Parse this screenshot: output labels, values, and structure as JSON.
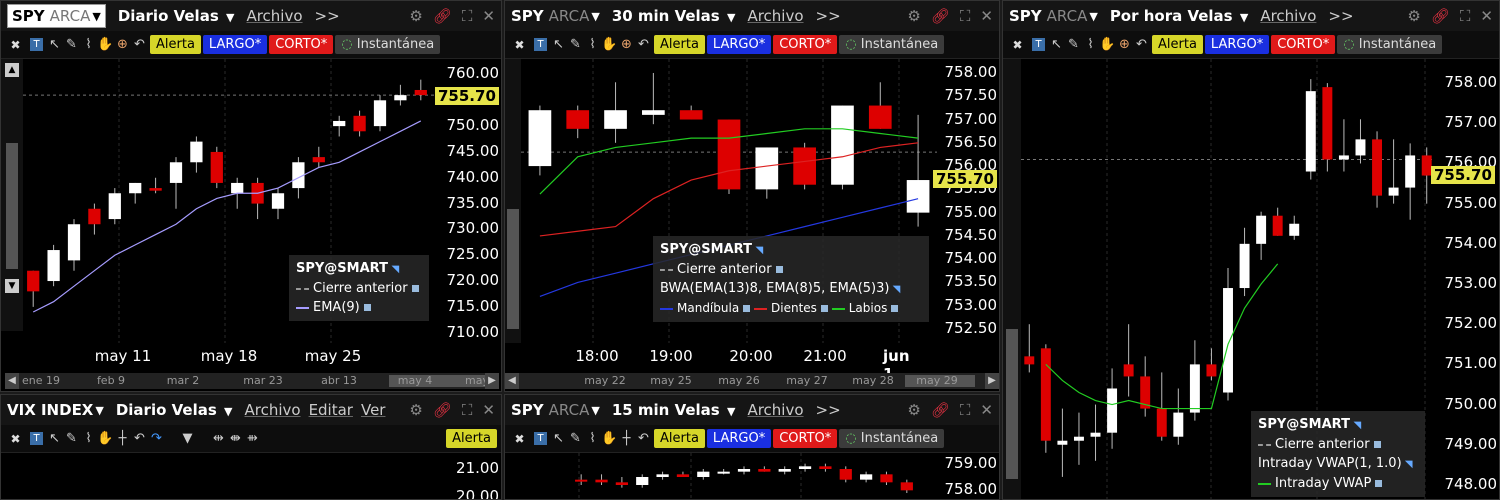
{
  "panels": {
    "p1": {
      "symbol": "SPY",
      "exchange": "ARCA",
      "title": "Diario Velas",
      "menu": "Archivo",
      "more": ">>",
      "buttons": {
        "alert": "Alerta",
        "long": "LARGO*",
        "short": "CORTO*",
        "snapshot": "Instantánea"
      },
      "last_price": "755.70",
      "y_labels": [
        "760.00",
        "755.00",
        "750.00",
        "745.00",
        "740.00",
        "735.00",
        "730.00",
        "725.00",
        "720.00",
        "715.00",
        "710.00"
      ],
      "x_labels": [
        "may 11",
        "may 18",
        "may 25"
      ],
      "nav_labels": [
        "ene 19",
        "feb 9",
        "mar 2",
        "mar 23",
        "abr 13",
        "may 4",
        "may"
      ],
      "legend": {
        "head": "SPY@SMART",
        "prev_close": "Cierre anterior",
        "ema": "EMA(9)"
      }
    },
    "p2": {
      "symbol": "SPY",
      "exchange": "ARCA",
      "title": "30 min Velas",
      "menu": "Archivo",
      "more": ">>",
      "buttons": {
        "alert": "Alerta",
        "long": "LARGO*",
        "short": "CORTO*",
        "snapshot": "Instantánea"
      },
      "last_price": "755.70",
      "y_labels": [
        "758.00",
        "757.50",
        "757.00",
        "756.50",
        "756.00",
        "755.50",
        "755.00",
        "754.50",
        "754.00",
        "753.50",
        "753.00",
        "752.50"
      ],
      "x_labels": [
        "18:00",
        "19:00",
        "20:00",
        "21:00",
        "jun 1"
      ],
      "nav_labels": [
        "may 22",
        "may 25",
        "may 26",
        "may 27",
        "may 28",
        "may 29"
      ],
      "legend": {
        "head": "SPY@SMART",
        "prev_close": "Cierre anterior",
        "bwa": "BWA(EMA(13)8, EMA(8)5, EMA(5)3)",
        "jaw": "Mandíbula",
        "teeth": "Dientes",
        "lips": "Labios"
      }
    },
    "p3": {
      "symbol": "SPY",
      "exchange": "ARCA",
      "title": "Por hora Velas",
      "menu": "Archivo",
      "more": ">>",
      "buttons": {
        "alert": "Alerta",
        "long": "LARGO*",
        "short": "CORTO*",
        "snapshot": "Instantánea"
      },
      "last_price": "755.70",
      "y_labels": [
        "758.00",
        "757.00",
        "756.00",
        "755.00",
        "754.00",
        "753.00",
        "752.00",
        "751.00",
        "750.00",
        "749.00",
        "748.00"
      ],
      "legend": {
        "head": "SPY@SMART",
        "prev_close": "Cierre anterior",
        "vwap": "Intraday VWAP(1, 1.0)",
        "vwap_line": "Intraday VWAP"
      }
    },
    "p4": {
      "symbol": "VIX INDEX",
      "title": "Diario Velas",
      "menus": [
        "Archivo",
        "Editar",
        "Ver"
      ],
      "buttons": {
        "alert": "Alerta"
      },
      "y_labels": [
        "21.00",
        "20.00"
      ]
    },
    "p5": {
      "symbol": "SPY",
      "exchange": "ARCA",
      "title": "15 min Velas",
      "menu": "Archivo",
      "more": ">>",
      "buttons": {
        "alert": "Alerta",
        "long": "LARGO*",
        "short": "CORTO*",
        "snapshot": "Instantánea"
      },
      "y_labels": [
        "759.00",
        "758.00"
      ]
    }
  },
  "chart_data": [
    {
      "type": "candlestick",
      "title": "SPY ARCA Diario Velas",
      "ylim": [
        708,
        763
      ],
      "last": 755.7,
      "ema_label": "EMA(9)",
      "candles": [
        {
          "o": 718,
          "h": 722,
          "l": 715,
          "c": 722,
          "up": false
        },
        {
          "o": 720,
          "h": 727,
          "l": 719,
          "c": 726,
          "up": true
        },
        {
          "o": 724,
          "h": 732,
          "l": 722,
          "c": 731,
          "up": true
        },
        {
          "o": 731,
          "h": 735,
          "l": 729,
          "c": 734,
          "up": false
        },
        {
          "o": 732,
          "h": 738,
          "l": 731,
          "c": 737,
          "up": true
        },
        {
          "o": 737,
          "h": 739,
          "l": 735,
          "c": 739,
          "up": true
        },
        {
          "o": 738,
          "h": 740,
          "l": 737,
          "c": 737.5,
          "up": false
        },
        {
          "o": 739,
          "h": 744,
          "l": 734,
          "c": 743,
          "up": true
        },
        {
          "o": 743,
          "h": 748,
          "l": 741,
          "c": 747,
          "up": true
        },
        {
          "o": 745,
          "h": 746,
          "l": 738,
          "c": 739,
          "up": false
        },
        {
          "o": 739,
          "h": 740,
          "l": 734,
          "c": 737,
          "up": true
        },
        {
          "o": 739,
          "h": 740,
          "l": 732,
          "c": 735,
          "up": false
        },
        {
          "o": 734,
          "h": 738,
          "l": 732,
          "c": 737,
          "up": true
        },
        {
          "o": 738,
          "h": 744,
          "l": 736,
          "c": 743,
          "up": true
        },
        {
          "o": 744,
          "h": 746,
          "l": 742,
          "c": 743,
          "up": false
        },
        {
          "o": 750,
          "h": 752,
          "l": 748,
          "c": 751,
          "up": true
        },
        {
          "o": 752,
          "h": 753,
          "l": 748,
          "c": 749,
          "up": false
        },
        {
          "o": 750,
          "h": 756,
          "l": 749,
          "c": 755,
          "up": true
        },
        {
          "o": 755,
          "h": 758,
          "l": 754,
          "c": 756,
          "up": true
        },
        {
          "o": 757,
          "h": 759,
          "l": 755,
          "c": 756,
          "up": false
        }
      ],
      "ema": [
        714,
        716,
        719,
        722,
        725,
        727,
        729,
        731,
        734,
        736,
        737,
        737,
        738,
        740,
        742,
        743,
        745,
        747,
        749,
        751
      ]
    },
    {
      "type": "candlestick",
      "title": "SPY ARCA 30 min Velas",
      "ylim": [
        752.2,
        758.3
      ],
      "last": 755.7,
      "candles": [
        {
          "o": 757.2,
          "h": 757.3,
          "l": 755.8,
          "c": 756.0,
          "up": true
        },
        {
          "o": 757.2,
          "h": 757.3,
          "l": 756.6,
          "c": 756.8,
          "up": false
        },
        {
          "o": 756.8,
          "h": 757.8,
          "l": 756.5,
          "c": 757.2,
          "up": true
        },
        {
          "o": 757.1,
          "h": 758.0,
          "l": 756.9,
          "c": 757.2,
          "up": true
        },
        {
          "o": 757.2,
          "h": 757.3,
          "l": 757.0,
          "c": 757.0,
          "up": false
        },
        {
          "o": 757.0,
          "h": 757.0,
          "l": 755.4,
          "c": 755.5,
          "up": false
        },
        {
          "o": 755.5,
          "h": 756.4,
          "l": 755.3,
          "c": 756.4,
          "up": true
        },
        {
          "o": 756.4,
          "h": 756.5,
          "l": 755.5,
          "c": 755.6,
          "up": false
        },
        {
          "o": 755.6,
          "h": 757.3,
          "l": 755.5,
          "c": 757.3,
          "up": true
        },
        {
          "o": 757.3,
          "h": 757.8,
          "l": 756.8,
          "c": 756.8,
          "up": false
        },
        {
          "o": 755.0,
          "h": 757.1,
          "l": 754.7,
          "c": 755.7,
          "up": true
        }
      ],
      "jaw": [
        753.2,
        753.5,
        753.7,
        753.9,
        754.1,
        754.3,
        754.5,
        754.7,
        754.9,
        755.1,
        755.3
      ],
      "teeth": [
        754.5,
        754.6,
        754.7,
        755.3,
        755.7,
        755.9,
        756.0,
        756.1,
        756.2,
        756.4,
        756.5
      ],
      "lips": [
        755.4,
        756.2,
        756.4,
        756.5,
        756.6,
        756.6,
        756.7,
        756.8,
        756.8,
        756.7,
        756.6
      ]
    },
    {
      "type": "candlestick",
      "title": "SPY ARCA Por hora Velas",
      "ylim": [
        747.6,
        758.6
      ],
      "last": 755.7,
      "candles": [
        {
          "o": 751.2,
          "h": 752.0,
          "l": 750.8,
          "c": 751.0,
          "up": false
        },
        {
          "o": 751.4,
          "h": 751.5,
          "l": 748.8,
          "c": 749.1,
          "up": false
        },
        {
          "o": 749.0,
          "h": 749.9,
          "l": 748.2,
          "c": 749.1,
          "up": true
        },
        {
          "o": 749.1,
          "h": 749.8,
          "l": 748.5,
          "c": 749.2,
          "up": true
        },
        {
          "o": 749.2,
          "h": 750.0,
          "l": 748.6,
          "c": 749.3,
          "up": true
        },
        {
          "o": 749.3,
          "h": 750.9,
          "l": 748.9,
          "c": 750.4,
          "up": true
        },
        {
          "o": 751.0,
          "h": 752.0,
          "l": 750.2,
          "c": 750.7,
          "up": false
        },
        {
          "o": 750.7,
          "h": 751.2,
          "l": 749.7,
          "c": 749.9,
          "up": false
        },
        {
          "o": 749.9,
          "h": 750.8,
          "l": 749.1,
          "c": 749.2,
          "up": false
        },
        {
          "o": 749.2,
          "h": 750.4,
          "l": 749.0,
          "c": 749.8,
          "up": true
        },
        {
          "o": 749.8,
          "h": 751.6,
          "l": 749.6,
          "c": 751.0,
          "up": true
        },
        {
          "o": 751.0,
          "h": 751.4,
          "l": 750.6,
          "c": 750.7,
          "up": false
        },
        {
          "o": 750.3,
          "h": 753.4,
          "l": 750.1,
          "c": 752.9,
          "up": true
        },
        {
          "o": 752.9,
          "h": 754.4,
          "l": 752.7,
          "c": 754.0,
          "up": true
        },
        {
          "o": 754.0,
          "h": 754.8,
          "l": 753.6,
          "c": 754.7,
          "up": true
        },
        {
          "o": 754.7,
          "h": 754.9,
          "l": 754.2,
          "c": 754.2,
          "up": false
        },
        {
          "o": 754.2,
          "h": 754.7,
          "l": 754.1,
          "c": 754.5,
          "up": true
        },
        {
          "o": 755.8,
          "h": 758.1,
          "l": 755.6,
          "c": 757.8,
          "up": true
        },
        {
          "o": 757.9,
          "h": 758.0,
          "l": 755.8,
          "c": 756.1,
          "up": false
        },
        {
          "o": 756.1,
          "h": 757.1,
          "l": 755.8,
          "c": 756.2,
          "up": true
        },
        {
          "o": 756.2,
          "h": 757.1,
          "l": 756.0,
          "c": 756.6,
          "up": true
        },
        {
          "o": 756.6,
          "h": 756.8,
          "l": 754.9,
          "c": 755.2,
          "up": false
        },
        {
          "o": 755.2,
          "h": 756.6,
          "l": 755.0,
          "c": 755.4,
          "up": true
        },
        {
          "o": 755.4,
          "h": 756.5,
          "l": 754.6,
          "c": 756.2,
          "up": true
        },
        {
          "o": 756.2,
          "h": 756.4,
          "l": 755.0,
          "c": 755.7,
          "up": false
        }
      ],
      "vwap": [
        null,
        751.0,
        750.6,
        750.3,
        750.1,
        750.0,
        750.1,
        750.0,
        749.9,
        749.9,
        749.9,
        749.9,
        751.5,
        752.4,
        753.0,
        753.5
      ]
    },
    {
      "type": "candlestick",
      "title": "SPY ARCA 15 min Velas",
      "ylim": [
        757.6,
        759.4
      ],
      "candles": [
        {
          "o": 758.4,
          "h": 758.6,
          "l": 758.2,
          "c": 758.4,
          "up": false
        },
        {
          "o": 758.4,
          "h": 758.6,
          "l": 758.2,
          "c": 758.3,
          "up": false
        },
        {
          "o": 758.3,
          "h": 758.5,
          "l": 758.1,
          "c": 758.2,
          "up": false
        },
        {
          "o": 758.2,
          "h": 758.6,
          "l": 758.1,
          "c": 758.5,
          "up": true
        },
        {
          "o": 758.5,
          "h": 758.7,
          "l": 758.4,
          "c": 758.6,
          "up": true
        },
        {
          "o": 758.6,
          "h": 758.7,
          "l": 758.5,
          "c": 758.5,
          "up": false
        },
        {
          "o": 758.5,
          "h": 758.8,
          "l": 758.4,
          "c": 758.7,
          "up": true
        },
        {
          "o": 758.7,
          "h": 758.8,
          "l": 758.6,
          "c": 758.7,
          "up": true
        },
        {
          "o": 758.7,
          "h": 758.9,
          "l": 758.6,
          "c": 758.8,
          "up": true
        },
        {
          "o": 758.8,
          "h": 758.9,
          "l": 758.7,
          "c": 758.7,
          "up": false
        },
        {
          "o": 758.7,
          "h": 758.9,
          "l": 758.6,
          "c": 758.8,
          "up": true
        },
        {
          "o": 758.8,
          "h": 759.0,
          "l": 758.7,
          "c": 758.9,
          "up": true
        },
        {
          "o": 758.9,
          "h": 759.0,
          "l": 758.7,
          "c": 758.8,
          "up": false
        },
        {
          "o": 758.8,
          "h": 758.9,
          "l": 758.3,
          "c": 758.4,
          "up": false
        },
        {
          "o": 758.4,
          "h": 758.7,
          "l": 758.3,
          "c": 758.6,
          "up": true
        },
        {
          "o": 758.6,
          "h": 758.7,
          "l": 758.2,
          "c": 758.3,
          "up": false
        },
        {
          "o": 758.3,
          "h": 758.4,
          "l": 757.9,
          "c": 758.0,
          "up": false
        }
      ]
    }
  ]
}
